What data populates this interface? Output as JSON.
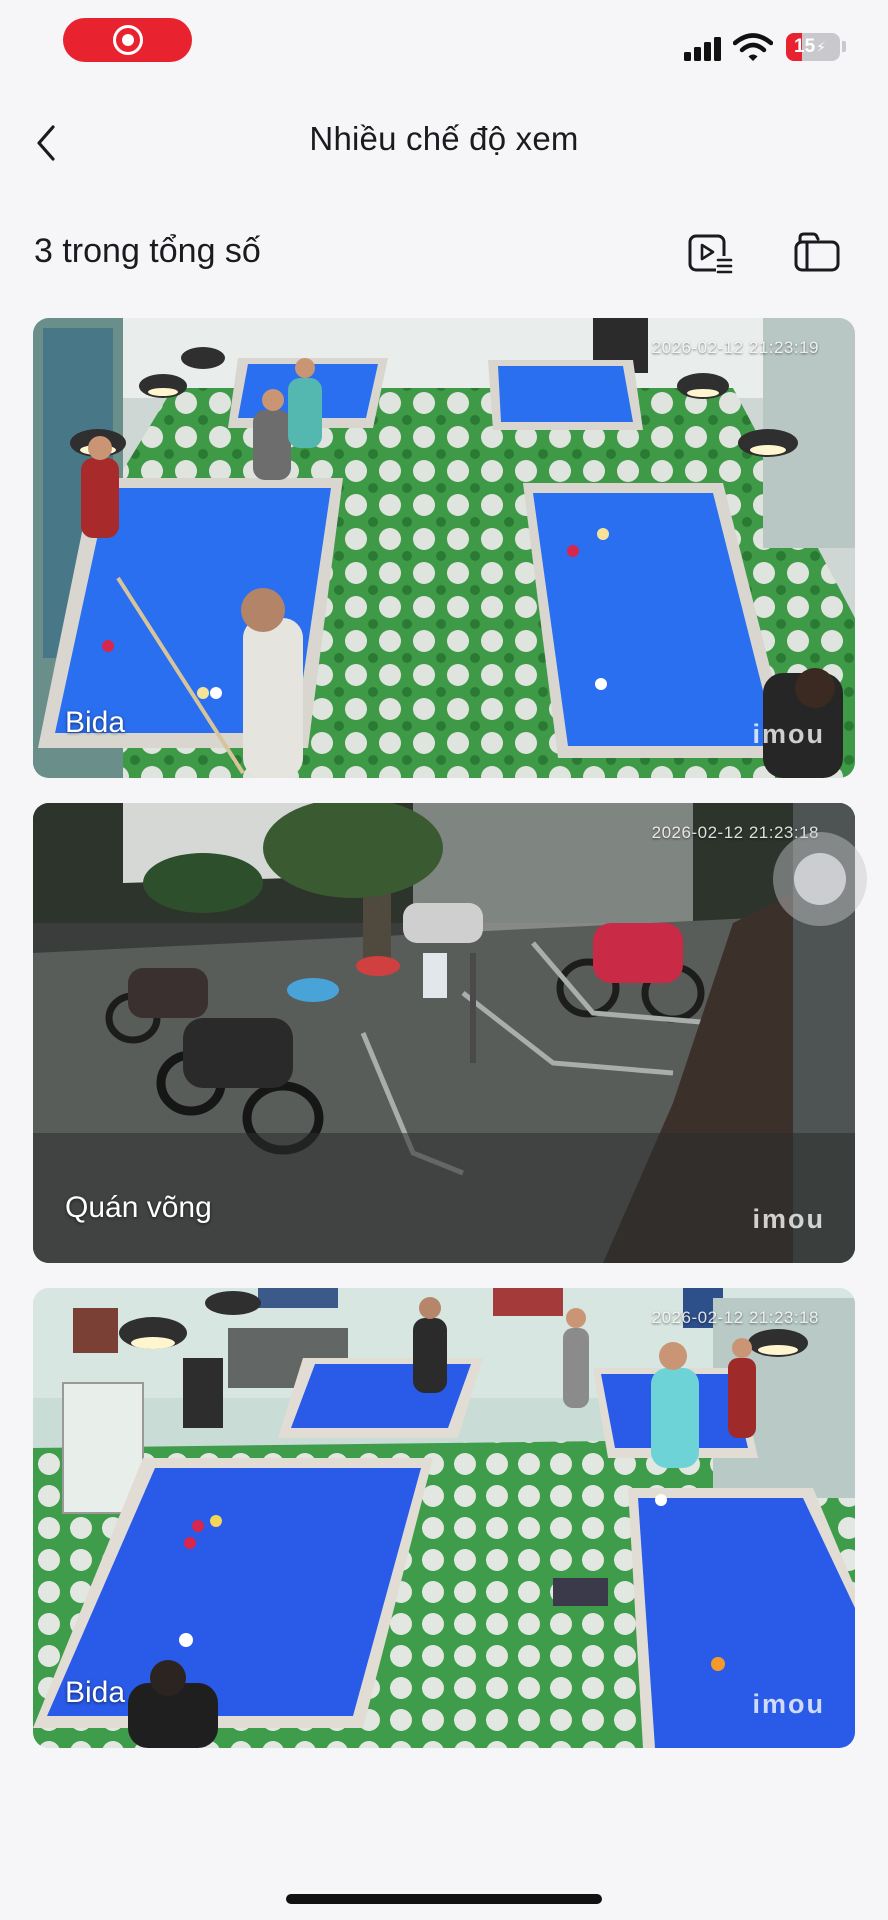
{
  "status_bar": {
    "battery": "15",
    "battery_level": 0.15,
    "record_color": "#e8232f"
  },
  "header": {
    "title": "Nhiều chế độ xem",
    "back_icon": "chevron-left-icon"
  },
  "toolbar": {
    "count_label": "3 trong tổng số",
    "playlist_icon": "video-playlist-icon",
    "multiview_icon": "multi-view-icon"
  },
  "cameras": [
    {
      "name": "Bida",
      "timestamp": "2026-02-12 21:23:19",
      "logo": "imou"
    },
    {
      "name": "Quán võng",
      "timestamp": "2026-02-12 21:23:18",
      "logo": "imou"
    },
    {
      "name": "Bida",
      "timestamp": "2026-02-12 21:23:18",
      "logo": "imou"
    }
  ],
  "colors": {
    "accent": "#e8232f",
    "table_cloth": "#2f6fe8",
    "floor": "#2e8a3a"
  }
}
